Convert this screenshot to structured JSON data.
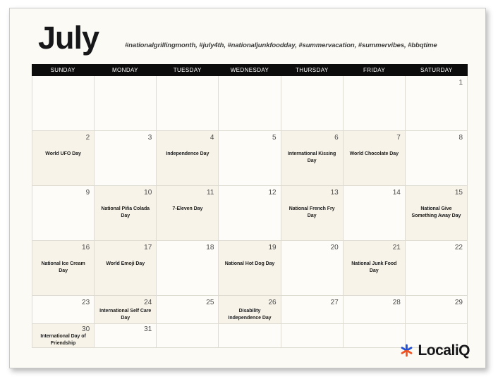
{
  "header": {
    "month_title": "July",
    "hashtags": "#nationalgrillingmonth, #july4th, #nationaljunkfoodday, #summervacation, #summervibes, #bbqtime"
  },
  "weekdays": [
    "SUNDAY",
    "MONDAY",
    "TUESDAY",
    "WEDNESDAY",
    "THURSDAY",
    "FRIDAY",
    "SATURDAY"
  ],
  "weeks": [
    [
      {
        "date": "",
        "event": ""
      },
      {
        "date": "",
        "event": ""
      },
      {
        "date": "",
        "event": ""
      },
      {
        "date": "",
        "event": ""
      },
      {
        "date": "",
        "event": ""
      },
      {
        "date": "",
        "event": ""
      },
      {
        "date": "1",
        "event": ""
      }
    ],
    [
      {
        "date": "2",
        "event": "World UFO Day"
      },
      {
        "date": "3",
        "event": ""
      },
      {
        "date": "4",
        "event": "Independence Day"
      },
      {
        "date": "5",
        "event": ""
      },
      {
        "date": "6",
        "event": "International Kissing Day"
      },
      {
        "date": "7",
        "event": "World Chocolate Day"
      },
      {
        "date": "8",
        "event": ""
      }
    ],
    [
      {
        "date": "9",
        "event": ""
      },
      {
        "date": "10",
        "event": "National Piña Colada Day"
      },
      {
        "date": "11",
        "event": "7-Eleven Day"
      },
      {
        "date": "12",
        "event": ""
      },
      {
        "date": "13",
        "event": "National French Fry Day"
      },
      {
        "date": "14",
        "event": ""
      },
      {
        "date": "15",
        "event": "National Give Something Away Day"
      }
    ],
    [
      {
        "date": "16",
        "event": "National Ice Cream Day"
      },
      {
        "date": "17",
        "event": "World Emoji Day"
      },
      {
        "date": "18",
        "event": ""
      },
      {
        "date": "19",
        "event": "National Hot Dog Day"
      },
      {
        "date": "20",
        "event": ""
      },
      {
        "date": "21",
        "event": "National Junk Food Day"
      },
      {
        "date": "22",
        "event": ""
      }
    ],
    [
      {
        "date": "23",
        "event": ""
      },
      {
        "date": "24",
        "event": "International Self Care Day"
      },
      {
        "date": "25",
        "event": ""
      },
      {
        "date": "26",
        "event": "Disability Independence Day"
      },
      {
        "date": "27",
        "event": ""
      },
      {
        "date": "28",
        "event": ""
      },
      {
        "date": "29",
        "event": ""
      }
    ]
  ],
  "overflow_week": [
    {
      "date": "30",
      "event": "International Day of Friendship"
    },
    {
      "date": "31",
      "event": ""
    },
    {
      "date": "",
      "event": ""
    },
    {
      "date": "",
      "event": ""
    },
    {
      "date": "",
      "event": ""
    },
    {
      "date": "",
      "event": ""
    },
    {
      "date": "",
      "event": ""
    }
  ],
  "brand": {
    "name": "LocaliQ",
    "mark_icon": "asterisk-starburst-icon",
    "mark_color_primary": "#1f4ed8",
    "mark_color_secondary": "#f4511e"
  },
  "colors": {
    "header_bar": "#0c0c0c",
    "cell_default": "#fdfcf8",
    "cell_event": "#f7f3e9",
    "grid_line": "#dedbd2",
    "card_bg": "#fbfaf5",
    "text_primary": "#17171a",
    "text_date": "#4a4a4a"
  }
}
